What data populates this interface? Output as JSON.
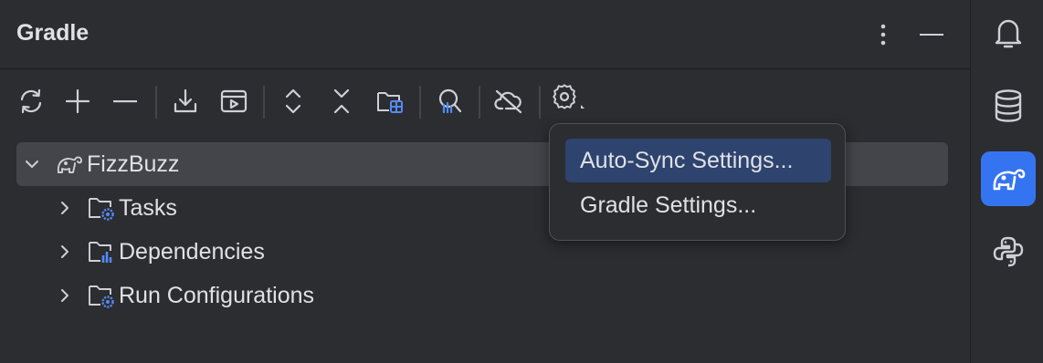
{
  "panel": {
    "title": "Gradle",
    "header_buttons": [
      "more-options-icon",
      "minimize-icon"
    ]
  },
  "toolbar": {
    "buttons": [
      "sync-icon",
      "add-icon",
      "remove-icon",
      "download-sources-icon",
      "run-task-icon",
      "expand-all-icon",
      "collapse-all-icon",
      "folder-grid-icon",
      "analyze-dependencies-icon",
      "offline-mode-icon",
      "settings-icon"
    ]
  },
  "tree": {
    "root": {
      "label": "FizzBuzz",
      "icon": "gradle-elephant-icon",
      "expanded": true,
      "selected": true
    },
    "children": [
      {
        "label": "Tasks",
        "icon": "folder-gear-icon"
      },
      {
        "label": "Dependencies",
        "icon": "folder-chart-icon"
      },
      {
        "label": "Run Configurations",
        "icon": "folder-gear-icon"
      }
    ]
  },
  "menu": {
    "items": [
      {
        "label": "Auto-Sync Settings...",
        "highlighted": true
      },
      {
        "label": "Gradle Settings..."
      }
    ]
  },
  "rightbar": {
    "items": [
      "notifications-icon",
      "database-icon",
      "gradle-icon",
      "python-icon"
    ],
    "active": "gradle-icon"
  },
  "colors": {
    "background": "#2b2d30",
    "selection": "#43454a",
    "menu_highlight": "#2e436e",
    "accent": "#3574f0",
    "icon_blue": "#548af7"
  }
}
